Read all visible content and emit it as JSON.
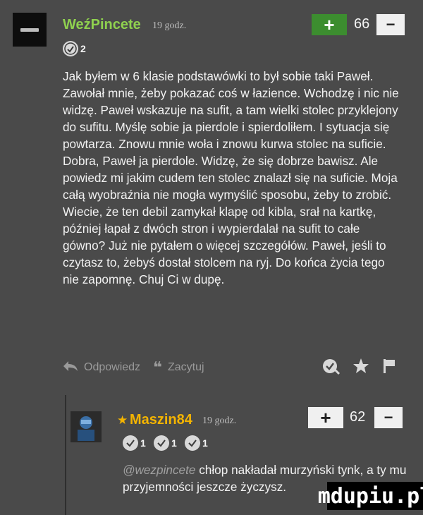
{
  "comment": {
    "author": "WeźPincete",
    "time": "19 godz.",
    "votes": "66",
    "badge_count": "2",
    "text": "Jak byłem w 6 klasie podstawówki to był sobie taki Paweł. Zawołał mnie, żeby pokazać coś w łazience. Wchodzę i nic nie widzę. Paweł wskazuje na sufit, a tam wielki stolec przyklejony do sufitu. Myślę sobie ja pierdole i spierdoliłem. I sytuacja się powtarza. Znowu mnie woła i znowu kurwa stolec na suficie. Dobra, Paweł ja pierdole. Widzę, że się dobrze bawisz. Ale powiedz mi jakim cudem ten stolec znalazł się na suficie. Moja całą wyobraźnia nie mogła wymyślić sposobu, żeby to zrobić. Wiecie, że ten debil zamykał klapę od kibla, srał na kartkę, później łapał z dwóch stron i wypierdalał na sufit to całe gówno? Już nie pytałem o więcej szczegółów. Paweł, jeśli to czytasz to, żebyś dostał stolcem na ryj. Do końca życia tego nie zapomnę. Chuj Ci w dupę.",
    "reply_label": "Odpowiedz",
    "quote_label": "Zacytuj"
  },
  "reply": {
    "author": "Maszin84",
    "time": "19 godz.",
    "votes": "62",
    "badges": [
      "1",
      "1",
      "1"
    ],
    "mention": "@wezpincete",
    "text": " chłop nakładał murzyński tynk, a ty mu przyjemności jeszcze życzysz."
  },
  "watermark": "mdupiu.pl",
  "colors": {
    "background": "#4a4a4a",
    "author_green": "#8fd14f",
    "author_gold": "#f4b400",
    "plus_green": "#3c8d2f"
  }
}
